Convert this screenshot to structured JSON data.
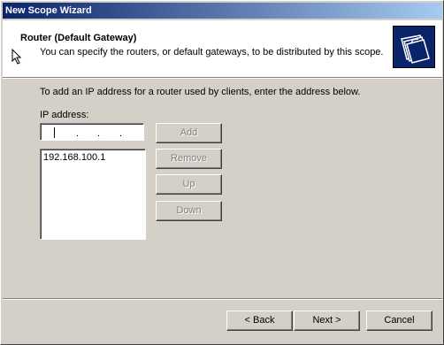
{
  "window": {
    "title": "New Scope Wizard"
  },
  "header": {
    "title": "Router (Default Gateway)",
    "subtitle": "You can specify the routers, or default gateways, to be distributed by this scope.",
    "icon": "folders-icon"
  },
  "content": {
    "instruction": "To add an IP address for a router used by clients, enter the address below.",
    "ip_label": "IP address:",
    "ip_value": "",
    "routers": [
      "192.168.100.1"
    ]
  },
  "buttons": {
    "add": "Add",
    "remove": "Remove",
    "up": "Up",
    "down": "Down"
  },
  "footer": {
    "back": "< Back",
    "next": "Next >",
    "cancel": "Cancel"
  }
}
